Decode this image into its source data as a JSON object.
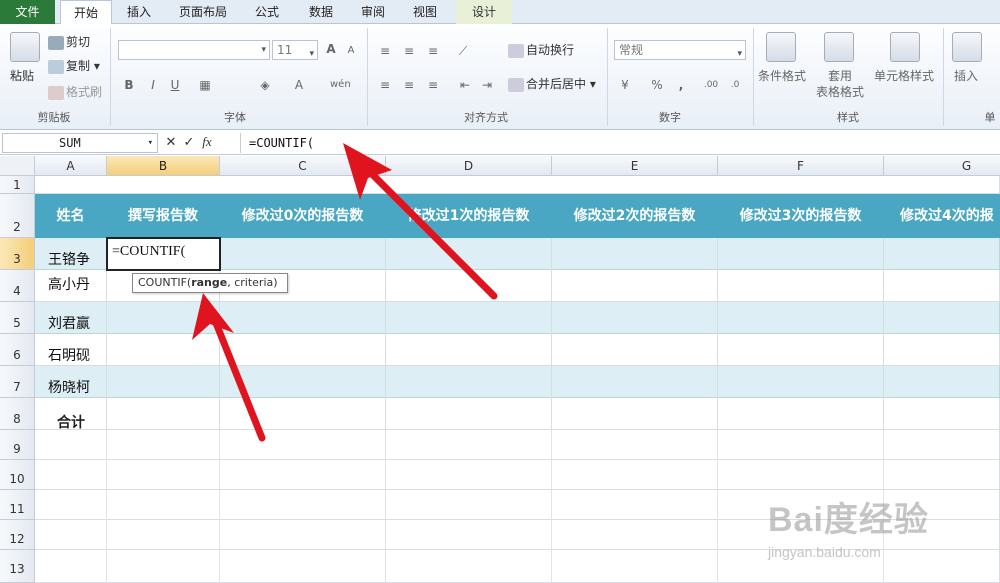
{
  "tabs": [
    {
      "label": "文件"
    },
    {
      "label": "开始"
    },
    {
      "label": "插入"
    },
    {
      "label": "页面布局"
    },
    {
      "label": "公式"
    },
    {
      "label": "数据"
    },
    {
      "label": "审阅"
    },
    {
      "label": "视图"
    },
    {
      "label": "设计"
    }
  ],
  "clipboard": {
    "paste": "粘贴",
    "cut": "剪切",
    "copy": "复制",
    "painter": "格式刷",
    "label": "剪贴板"
  },
  "font": {
    "size": "11",
    "label": "字体",
    "bold": "B",
    "italic": "I",
    "underline": "U",
    "grow": "A",
    "shrink": "A",
    "color_a": "A"
  },
  "alignment": {
    "wrap": "自动换行",
    "merge": "合并后居中",
    "label": "对齐方式"
  },
  "number": {
    "format": "常规",
    "percent": "%",
    "comma": ",",
    "label": "数字"
  },
  "styles": {
    "conditional": "条件格式",
    "table_format": "套用\n表格格式",
    "cell_styles": "单元格样式",
    "label": "样式"
  },
  "cells": {
    "insert": "插入",
    "label": "单"
  },
  "formula_bar": {
    "name_box": "SUM",
    "cancel": "✕",
    "enter": "✓",
    "fx": "fx",
    "content": "=COUNTIF("
  },
  "columns": [
    "A",
    "B",
    "C",
    "D",
    "E",
    "F",
    "G"
  ],
  "rows": [
    "1",
    "2",
    "3",
    "4",
    "5",
    "6",
    "7",
    "8",
    "9",
    "10",
    "11",
    "12",
    "13"
  ],
  "header_row": [
    "姓名",
    "撰写报告数",
    "修改过0次的报告数",
    "修改过1次的报告数",
    "修改过2次的报告数",
    "修改过3次的报告数",
    "修改过4次的报"
  ],
  "names": [
    "王铬争",
    "高小丹",
    "刘君赢",
    "石明砚",
    "杨晓柯"
  ],
  "total_label": "合计",
  "active_cell": {
    "value": "=COUNTIF("
  },
  "tooltip": {
    "func": "COUNTIF(",
    "range": "range",
    ", criteria)": ", criteria)"
  },
  "watermark": {
    "main": "Bai度经验",
    "sub": "jingyan.baidu.com"
  },
  "colors": {
    "header_fill": "#49a7c3",
    "band_fill": "#ddeef4",
    "arrow": "#e0141e",
    "selected_header": "#f4cf7a"
  }
}
